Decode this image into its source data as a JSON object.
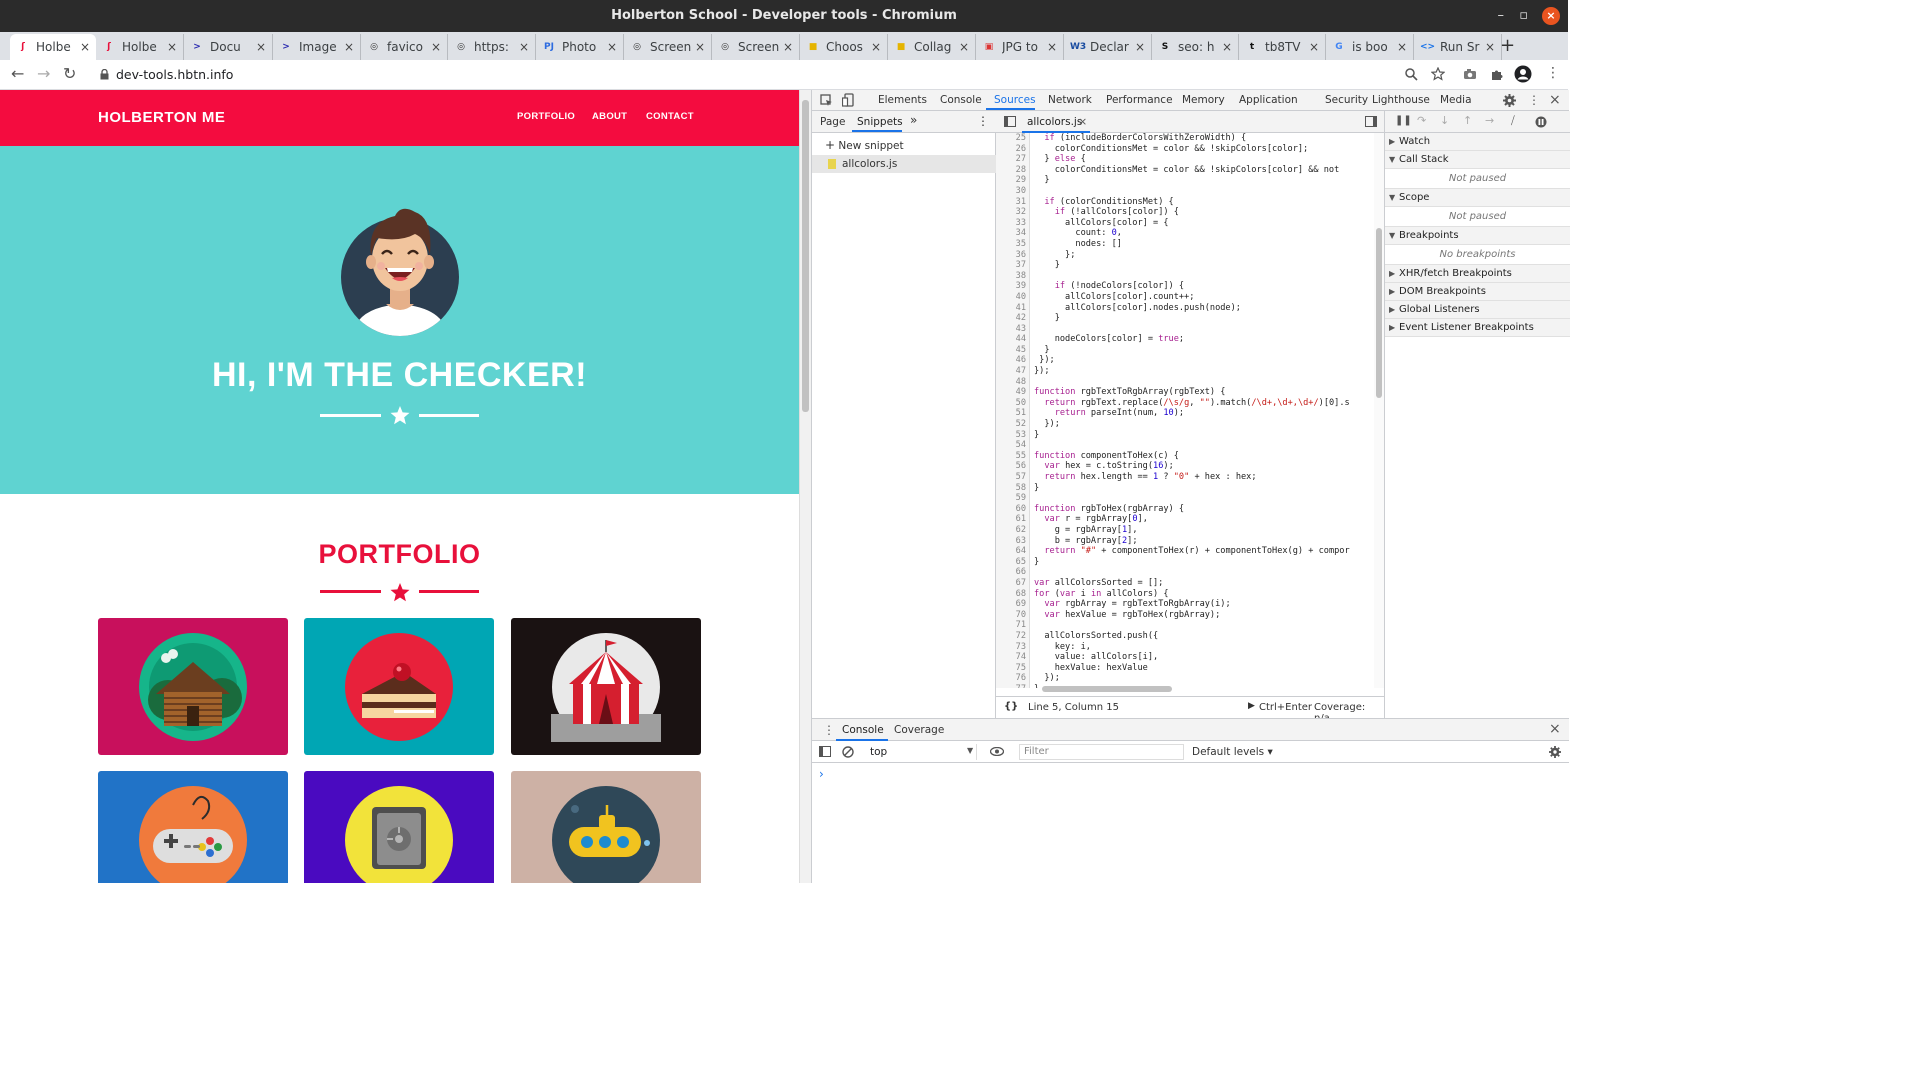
{
  "window": {
    "title": "Holberton School - Developer tools - Chromium",
    "close_glyph": "×",
    "minimize_glyph": "–",
    "maximize_glyph": "▫"
  },
  "tabs": [
    {
      "label": "Holbe",
      "favicon": "holberton",
      "color": "#e8103b",
      "active": true
    },
    {
      "label": "Holbe",
      "favicon": "holberton",
      "color": "#e8103b"
    },
    {
      "label": "Docu",
      "favicon": "terminal",
      "color": "#2b2bb0"
    },
    {
      "label": "Image",
      "favicon": "terminal",
      "color": "#2b2bb0"
    },
    {
      "label": "favico",
      "favicon": "globe",
      "color": "#333"
    },
    {
      "label": "https:",
      "favicon": "globe",
      "color": "#333"
    },
    {
      "label": "Photo",
      "favicon": "pj",
      "color": "#2d6be0"
    },
    {
      "label": "Screen",
      "favicon": "globe",
      "color": "#333"
    },
    {
      "label": "Screen",
      "favicon": "globe",
      "color": "#333"
    },
    {
      "label": "Choos",
      "favicon": "colors",
      "color": "#e5b400"
    },
    {
      "label": "Collag",
      "favicon": "colors",
      "color": "#e5b400"
    },
    {
      "label": "JPG to",
      "favicon": "jpg",
      "color": "#d33"
    },
    {
      "label": "Declar",
      "favicon": "w3",
      "color": "#1a4ca0"
    },
    {
      "label": "seo: h",
      "favicon": "stack",
      "color": "#111"
    },
    {
      "label": "tb8TV",
      "favicon": "box",
      "color": "#111"
    },
    {
      "label": "is boo",
      "favicon": "google",
      "color": "#4285f4"
    },
    {
      "label": "Run Sr",
      "favicon": "code",
      "color": "#1a73e8"
    }
  ],
  "tab_close_glyph": "×",
  "new_tab_glyph": "+",
  "toolbar": {
    "url": "dev-tools.hbtn.info",
    "back": "←",
    "forward": "→",
    "reload": "↻"
  },
  "site": {
    "brand": "HOLBERTON ME",
    "nav": [
      "PORTFOLIO",
      "ABOUT",
      "CONTACT"
    ],
    "hero_title": "HI, I'M THE CHECKER!",
    "portfolio_title": "PORTFOLIO",
    "star": "★",
    "colors": {
      "nav": "#f40c3f",
      "hero": "#5fd3d1",
      "accent": "#e8103b"
    },
    "cards": [
      {
        "name": "cabin",
        "bg": "#c8105c"
      },
      {
        "name": "cake",
        "bg": "#00a6b4"
      },
      {
        "name": "circus",
        "bg": "#1a1212"
      },
      {
        "name": "game-controller",
        "bg": "#2173c7"
      },
      {
        "name": "safe",
        "bg": "#4a0ac0"
      },
      {
        "name": "submarine",
        "bg": "#cdb1a5"
      }
    ]
  },
  "devtools": {
    "tabs": [
      "Elements",
      "Console",
      "Sources",
      "Network",
      "Performance",
      "Memory",
      "Application",
      "Security",
      "Lighthouse",
      "Media"
    ],
    "active_tab": "Sources",
    "nav_tabs": [
      "Page",
      "Snippets"
    ],
    "more_glyph": "»",
    "new_snippet": "New snippet",
    "snippet_file": "allcolors.js",
    "file_tab": "allcolors.js",
    "code_start_line": 25,
    "code": [
      [
        [
          "  ",
          "p"
        ],
        [
          "if",
          "k"
        ],
        [
          " (includeBorderColorsWithZeroWidth) {",
          "p"
        ]
      ],
      [
        [
          "    colorConditionsMet = color && !skipColors[color];",
          "p"
        ]
      ],
      [
        [
          "  } ",
          "p"
        ],
        [
          "else",
          "k"
        ],
        [
          " {",
          "p"
        ]
      ],
      [
        [
          "    colorConditionsMet = color && !skipColors[color] && not",
          "p"
        ]
      ],
      [
        [
          "  }",
          "p"
        ]
      ],
      [
        [
          "",
          "p"
        ]
      ],
      [
        [
          "  ",
          "p"
        ],
        [
          "if",
          "k"
        ],
        [
          " (colorConditionsMet) {",
          "p"
        ]
      ],
      [
        [
          "    ",
          "p"
        ],
        [
          "if",
          "k"
        ],
        [
          " (!allColors[color]) {",
          "p"
        ]
      ],
      [
        [
          "      allColors[color] = {",
          "p"
        ]
      ],
      [
        [
          "        count: ",
          "p"
        ],
        [
          "0",
          "n"
        ],
        [
          ",",
          "p"
        ]
      ],
      [
        [
          "        nodes: []",
          "p"
        ]
      ],
      [
        [
          "      };",
          "p"
        ]
      ],
      [
        [
          "    }",
          "p"
        ]
      ],
      [
        [
          "",
          "p"
        ]
      ],
      [
        [
          "    ",
          "p"
        ],
        [
          "if",
          "k"
        ],
        [
          " (!nodeColors[color]) {",
          "p"
        ]
      ],
      [
        [
          "      allColors[color].count++;",
          "p"
        ]
      ],
      [
        [
          "      allColors[color].nodes.push(node);",
          "p"
        ]
      ],
      [
        [
          "    }",
          "p"
        ]
      ],
      [
        [
          "",
          "p"
        ]
      ],
      [
        [
          "    nodeColors[color] = ",
          "p"
        ],
        [
          "true",
          "k"
        ],
        [
          ";",
          "p"
        ]
      ],
      [
        [
          "  }",
          "p"
        ]
      ],
      [
        [
          " });",
          "p"
        ]
      ],
      [
        [
          "});",
          "p"
        ]
      ],
      [
        [
          "",
          "p"
        ]
      ],
      [
        [
          "function",
          "k"
        ],
        [
          " rgbTextToRgbArray(rgbText) {",
          "p"
        ]
      ],
      [
        [
          "  ",
          "p"
        ],
        [
          "return",
          "k"
        ],
        [
          " rgbText.replace(",
          "p"
        ],
        [
          "/\\s/g",
          "s"
        ],
        [
          ", ",
          "p"
        ],
        [
          "\"\"",
          "s"
        ],
        [
          ").match(",
          "p"
        ],
        [
          "/\\d+,\\d+,\\d+/",
          "s"
        ],
        [
          ")[0].s",
          "p"
        ]
      ],
      [
        [
          "    ",
          "p"
        ],
        [
          "return",
          "k"
        ],
        [
          " parseInt(num, ",
          "p"
        ],
        [
          "10",
          "n"
        ],
        [
          ");",
          "p"
        ]
      ],
      [
        [
          "  });",
          "p"
        ]
      ],
      [
        [
          "}",
          "p"
        ]
      ],
      [
        [
          "",
          "p"
        ]
      ],
      [
        [
          "function",
          "k"
        ],
        [
          " componentToHex(c) {",
          "p"
        ]
      ],
      [
        [
          "  ",
          "p"
        ],
        [
          "var",
          "k"
        ],
        [
          " hex = c.toString(",
          "p"
        ],
        [
          "16",
          "n"
        ],
        [
          ");",
          "p"
        ]
      ],
      [
        [
          "  ",
          "p"
        ],
        [
          "return",
          "k"
        ],
        [
          " hex.length == ",
          "p"
        ],
        [
          "1",
          "n"
        ],
        [
          " ? ",
          "p"
        ],
        [
          "\"0\"",
          "s"
        ],
        [
          " + hex : hex;",
          "p"
        ]
      ],
      [
        [
          "}",
          "p"
        ]
      ],
      [
        [
          "",
          "p"
        ]
      ],
      [
        [
          "function",
          "k"
        ],
        [
          " rgbToHex(rgbArray) {",
          "p"
        ]
      ],
      [
        [
          "  ",
          "p"
        ],
        [
          "var",
          "k"
        ],
        [
          " r = rgbArray[",
          "p"
        ],
        [
          "0",
          "n"
        ],
        [
          "],",
          "p"
        ]
      ],
      [
        [
          "    g = rgbArray[",
          "p"
        ],
        [
          "1",
          "n"
        ],
        [
          "],",
          "p"
        ]
      ],
      [
        [
          "    b = rgbArray[",
          "p"
        ],
        [
          "2",
          "n"
        ],
        [
          "];",
          "p"
        ]
      ],
      [
        [
          "  ",
          "p"
        ],
        [
          "return",
          "k"
        ],
        [
          " ",
          "p"
        ],
        [
          "\"#\"",
          "s"
        ],
        [
          " + componentToHex(r) + componentToHex(g) + compor",
          "p"
        ]
      ],
      [
        [
          "}",
          "p"
        ]
      ],
      [
        [
          "",
          "p"
        ]
      ],
      [
        [
          "var",
          "k"
        ],
        [
          " allColorsSorted = [];",
          "p"
        ]
      ],
      [
        [
          "for",
          "k"
        ],
        [
          " (",
          "p"
        ],
        [
          "var",
          "k"
        ],
        [
          " i ",
          "p"
        ],
        [
          "in",
          "k"
        ],
        [
          " allColors) {",
          "p"
        ]
      ],
      [
        [
          "  ",
          "p"
        ],
        [
          "var",
          "k"
        ],
        [
          " rgbArray = rgbTextToRgbArray(i);",
          "p"
        ]
      ],
      [
        [
          "  ",
          "p"
        ],
        [
          "var",
          "k"
        ],
        [
          " hexValue = rgbToHex(rgbArray);",
          "p"
        ]
      ],
      [
        [
          "",
          "p"
        ]
      ],
      [
        [
          "  allColorsSorted.push({",
          "p"
        ]
      ],
      [
        [
          "    key: i,",
          "p"
        ]
      ],
      [
        [
          "    value: allColors[i],",
          "p"
        ]
      ],
      [
        [
          "    hexValue: hexValue",
          "p"
        ]
      ],
      [
        [
          "  });",
          "p"
        ]
      ],
      [
        [
          "}",
          "p"
        ]
      ]
    ],
    "status": {
      "pretty": "{}",
      "position": "Line 5, Column 15",
      "run": "Ctrl+Enter",
      "coverage": "Coverage: n/a"
    },
    "debugger": {
      "sections": [
        {
          "label": "Watch",
          "open": false
        },
        {
          "label": "Call Stack",
          "open": true,
          "empty": "Not paused"
        },
        {
          "label": "Scope",
          "open": true,
          "empty": "Not paused"
        },
        {
          "label": "Breakpoints",
          "open": true,
          "empty": "No breakpoints"
        },
        {
          "label": "XHR/fetch Breakpoints",
          "open": false
        },
        {
          "label": "DOM Breakpoints",
          "open": false
        },
        {
          "label": "Global Listeners",
          "open": false
        },
        {
          "label": "Event Listener Breakpoints",
          "open": false
        }
      ]
    },
    "drawer": {
      "tabs": [
        "Console",
        "Coverage"
      ],
      "context": "top",
      "filter_placeholder": "Filter",
      "levels": "Default levels ▾",
      "prompt": "›"
    }
  }
}
